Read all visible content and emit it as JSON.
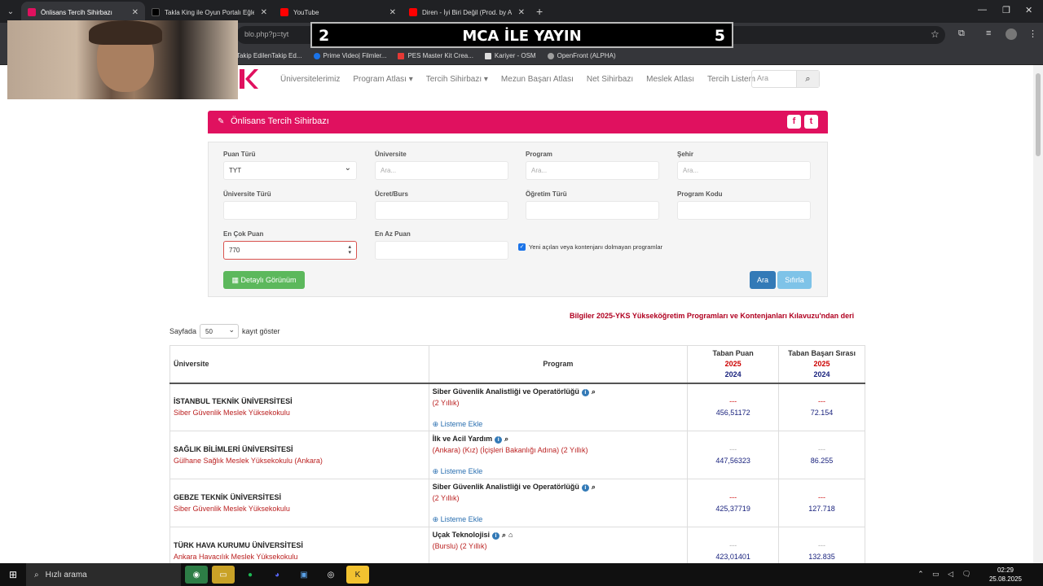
{
  "browser": {
    "tabs": [
      {
        "title": "Önlisans Tercih Sihirbazı",
        "active": true,
        "fav_color": "#e0115f"
      },
      {
        "title": "Takla King ile Oyun Portalı Eğle",
        "active": false,
        "fav_color": "#000000"
      },
      {
        "title": "YouTube",
        "active": false,
        "fav_color": "#ff0000"
      },
      {
        "title": "Diren - İyi Biri Değil (Prod. by A",
        "active": false,
        "fav_color": "#ff0000"
      }
    ],
    "url_fragment": "blo.php?p=tyt",
    "bookmarks": [
      "Takip EdilenTakip Ed...",
      "Prime Video| Filmler...",
      "PES Master Kit Crea...",
      "Kariyer - OSM",
      "OpenFront (ALPHA)"
    ]
  },
  "overlay": {
    "left": "2",
    "center": "MCA İLE YAYIN",
    "right": "5"
  },
  "site_nav": {
    "items": [
      "Üniversitelerimiz",
      "Program Atlası ▾",
      "Tercih Sihirbazı ▾",
      "Mezun Başarı Atlası",
      "Net Sihirbazı",
      "Meslek Atlası",
      "Tercih Listem"
    ],
    "search_placeholder": "Ara"
  },
  "panel": {
    "title": "Önlisans Tercih Sihirbazı"
  },
  "form": {
    "puan_turu_label": "Puan Türü",
    "puan_turu_value": "TYT",
    "universite_label": "Üniversite",
    "universite_placeholder": "Ara...",
    "program_label": "Program",
    "program_placeholder": "Ara...",
    "sehir_label": "Şehir",
    "sehir_placeholder": "Ara...",
    "universite_turu_label": "Üniversite Türü",
    "ucret_label": "Ücret/Burs",
    "ogretim_turu_label": "Öğretim Türü",
    "program_kodu_label": "Program Kodu",
    "en_cok_label": "En Çok Puan",
    "en_cok_value": "770",
    "en_az_label": "En Az Puan",
    "checkbox_label": "Yeni açılan veya kontenjanı dolmayan programlar",
    "detayli_label": "Detaylı Görünüm",
    "ara_label": "Ara",
    "sifirla_label": "Sıfırla"
  },
  "info_text": "Bilgiler 2025-YKS Yükseköğretim Programları ve Kontenjanları Kılavuzu'ndan deri",
  "perpage": {
    "prefix": "Sayfada",
    "value": "50",
    "suffix": "kayıt göster"
  },
  "table": {
    "headers": {
      "uni": "Üniversite",
      "prog": "Program",
      "taban_puan": "Taban Puan",
      "taban_sira": "Taban Başarı Sırası",
      "y1": "2025",
      "y2": "2024"
    },
    "add_label": "Listeme Ekle",
    "rows": [
      {
        "uni": "İSTANBUL TEKNİK ÜNİVERSİTESİ",
        "school": "Siber Güvenlik Meslek Yüksekokulu",
        "prog": "Siber Güvenlik Analistliği ve Operatörlüğü",
        "detail": "(2 Yıllık)",
        "d1": "---",
        "puan": "456,51172",
        "d2": "---",
        "sira": "72.154"
      },
      {
        "uni": "SAĞLIK BİLİMLERİ ÜNİVERSİTESİ",
        "school": "Gülhane Sağlık Meslek Yüksekokulu (Ankara)",
        "prog": "İlk ve Acil Yardım",
        "detail": "(Ankara) (Kız) (İçişleri Bakanlığı Adına) (2 Yıllık)",
        "d1": "---",
        "puan": "447,56323",
        "d2": "---",
        "sira": "86.255"
      },
      {
        "uni": "GEBZE TEKNİK ÜNİVERSİTESİ",
        "school": "Siber Güvenlik Meslek Yüksekokulu",
        "prog": "Siber Güvenlik Analistliği ve Operatörlüğü",
        "detail": "(2 Yıllık)",
        "d1": "---",
        "puan": "425,37719",
        "d2": "---",
        "sira": "127.718"
      },
      {
        "uni": "TÜRK HAVA KURUMU ÜNİVERSİTESİ",
        "school": "Ankara Havacılık Meslek Yüksekokulu",
        "prog": "Uçak Teknolojisi",
        "detail": "(Burslu) (2 Yıllık)",
        "d1": "---",
        "puan": "423,01401",
        "d2": "---",
        "sira": "132.835"
      }
    ]
  },
  "taskbar": {
    "search_label": "Hızlı arama",
    "time": "02:29",
    "date": "25.08.2025"
  }
}
